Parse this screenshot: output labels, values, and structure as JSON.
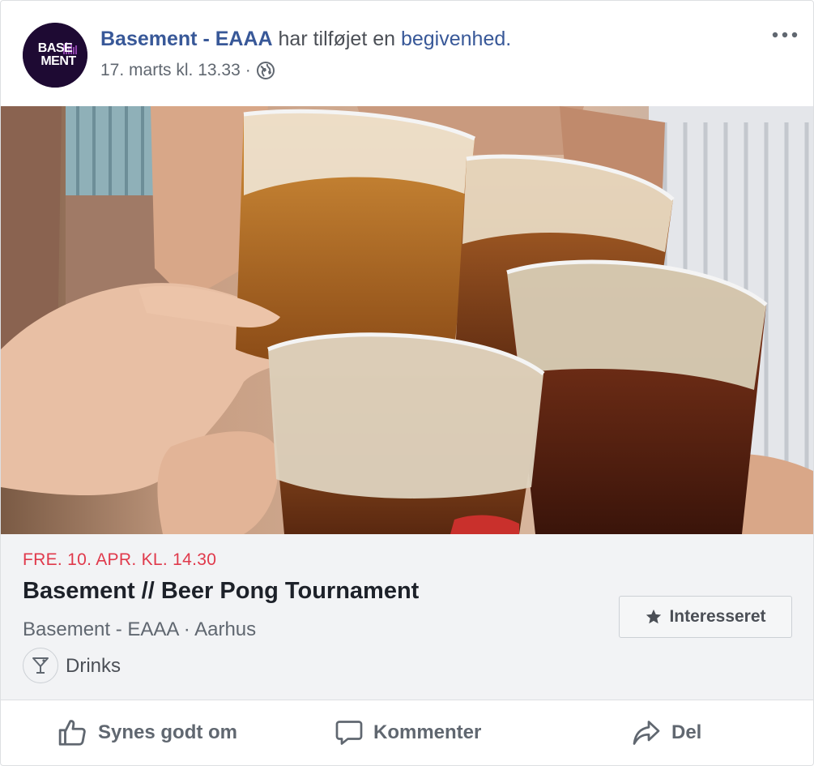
{
  "post": {
    "page_name": "Basement - EAAA",
    "action_text": " har tilføjet en ",
    "action_link": "begivenhed.",
    "timestamp": "17. marts kl. 13.33",
    "separator": "·",
    "privacy_icon": "globe-icon",
    "more_icon": "more-options-icon"
  },
  "avatar": {
    "line1": "BASE",
    "line2": "MENT",
    "background": "#1e0a33",
    "accent": "#8e44ad"
  },
  "event": {
    "date": "FRE. 10. APR. KL. 14.30",
    "title": "Basement // Beer Pong Tournament",
    "subtitle": "Basement - EAAA · Aarhus",
    "category": "Drinks",
    "category_icon": "cocktail-icon",
    "interested_label": "Interesseret",
    "interested_icon": "star-icon"
  },
  "actions": {
    "like": "Synes godt om",
    "comment": "Kommenter",
    "share": "Del"
  },
  "colors": {
    "link": "#385898",
    "date_red": "#e0394b",
    "text_dark": "#1d2129",
    "text_muted": "#606770",
    "event_bg": "#f2f3f5"
  }
}
